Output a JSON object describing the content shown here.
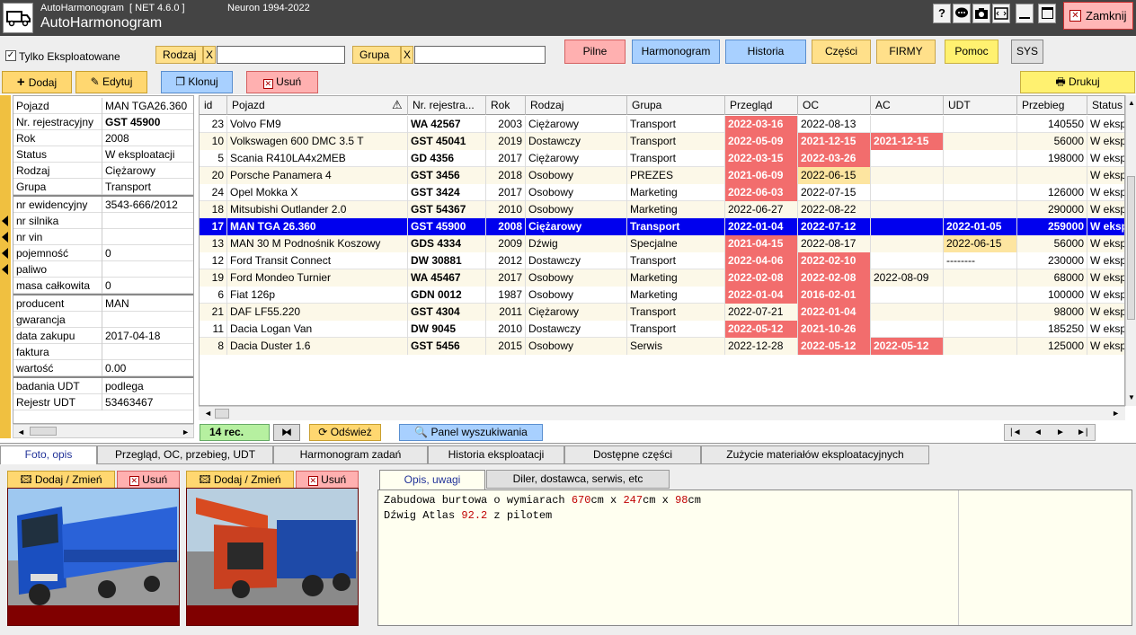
{
  "titlebar": {
    "app_small": "AutoHarmonogram  [ NET 4.6.0 ]",
    "app_title": "AutoHarmonogram",
    "version": "Neuron 1994-2022",
    "close_label": "Zamknij",
    "icons": [
      "help-icon",
      "chat-icon",
      "camera-icon",
      "screen-icon",
      "minimize-icon",
      "maximize-icon"
    ]
  },
  "filters": {
    "exploit_label": "Tylko Eksploatowane",
    "rodzaj_label": "Rodzaj",
    "grupa_label": "Grupa",
    "clear": "X",
    "rodzaj_value": "",
    "grupa_value": ""
  },
  "top_buttons": [
    "Pilne",
    "Harmonogram",
    "Historia",
    "Części",
    "FIRMY",
    "Pomoc",
    "SYS"
  ],
  "actions": {
    "add": "Dodaj",
    "edit": "Edytuj",
    "clone": "Klonuj",
    "delete": "Usuń",
    "print": "Drukuj"
  },
  "details": [
    {
      "k": "Pojazd",
      "v": "MAN TGA26.360"
    },
    {
      "k": "Nr. rejestracyjny",
      "v": "GST 45900",
      "bold": true
    },
    {
      "k": "Rok",
      "v": "2008"
    },
    {
      "k": "Status",
      "v": "W eksploatacji"
    },
    {
      "k": "Rodzaj",
      "v": "Ciężarowy"
    },
    {
      "k": "Grupa",
      "v": "Transport"
    },
    {
      "k": "nr ewidencyjny",
      "v": "3543-666/2012"
    },
    {
      "k": "nr silnika",
      "v": ""
    },
    {
      "k": "nr vin",
      "v": ""
    },
    {
      "k": "pojemność",
      "v": "0"
    },
    {
      "k": "paliwo",
      "v": ""
    },
    {
      "k": "masa całkowita",
      "v": "0"
    },
    {
      "k": "producent",
      "v": "MAN"
    },
    {
      "k": "gwarancja",
      "v": ""
    },
    {
      "k": "data zakupu",
      "v": "2017-04-18"
    },
    {
      "k": "faktura",
      "v": ""
    },
    {
      "k": "wartość",
      "v": "0.00"
    },
    {
      "k": "badania UDT",
      "v": "podlega"
    },
    {
      "k": "Rejestr UDT",
      "v": "53463467"
    }
  ],
  "grid": {
    "headers": [
      "id",
      "Pojazd",
      "Nr. rejestra...",
      "Rok",
      "Rodzaj",
      "Grupa",
      "Przegląd",
      "OC",
      "AC",
      "UDT",
      "Przebieg",
      "Status"
    ],
    "rows": [
      {
        "id": "23",
        "pojazd": "Volvo FM9",
        "nr": "WA 42567",
        "rok": "2003",
        "rodzaj": "Ciężarowy",
        "grupa": "Transport",
        "przeglad": "2022-03-16",
        "oc": "2022-08-13",
        "ac": "",
        "udt": "",
        "przebieg": "140550",
        "status": "W eksploatacji",
        "cls": [
          "red",
          "",
          "",
          ""
        ]
      },
      {
        "id": "10",
        "pojazd": "Volkswagen 600 DMC 3.5 T",
        "nr": "GST 45041",
        "rok": "2019",
        "rodzaj": "Dostawczy",
        "grupa": "Transport",
        "przeglad": "2022-05-09",
        "oc": "2021-12-15",
        "ac": "2021-12-15",
        "udt": "",
        "przebieg": "56000",
        "status": "W eksploatacji",
        "cls": [
          "red",
          "red",
          "red",
          ""
        ]
      },
      {
        "id": "5",
        "pojazd": "Scania R410LA4x2MEB",
        "nr": "GD 4356",
        "rok": "2017",
        "rodzaj": "Ciężarowy",
        "grupa": "Transport",
        "przeglad": "2022-03-15",
        "oc": "2022-03-26",
        "ac": "",
        "udt": "",
        "przebieg": "198000",
        "status": "W eksploatacji",
        "cls": [
          "red",
          "red",
          "",
          ""
        ]
      },
      {
        "id": "20",
        "pojazd": "Porsche Panamera 4",
        "nr": "GST 3456",
        "rok": "2018",
        "rodzaj": "Osobowy",
        "grupa": "PREZES",
        "przeglad": "2021-06-09",
        "oc": "2022-06-15",
        "ac": "",
        "udt": "",
        "przebieg": "",
        "status": "W eksploatacji",
        "cls": [
          "red",
          "yel",
          "",
          ""
        ]
      },
      {
        "id": "24",
        "pojazd": "Opel Mokka X",
        "nr": "GST 3424",
        "rok": "2017",
        "rodzaj": "Osobowy",
        "grupa": "Marketing",
        "przeglad": "2022-06-03",
        "oc": "2022-07-15",
        "ac": "",
        "udt": "",
        "przebieg": "126000",
        "status": "W eksploatacji",
        "cls": [
          "red",
          "",
          "",
          ""
        ]
      },
      {
        "id": "18",
        "pojazd": "Mitsubishi Outlander 2.0",
        "nr": "GST 54367",
        "rok": "2010",
        "rodzaj": "Osobowy",
        "grupa": "Marketing",
        "przeglad": "2022-06-27",
        "oc": "2022-08-22",
        "ac": "",
        "udt": "",
        "przebieg": "290000",
        "status": "W eksploatacji",
        "cls": [
          "",
          "",
          "",
          ""
        ]
      },
      {
        "id": "17",
        "pojazd": "MAN TGA 26.360",
        "nr": "GST 45900",
        "rok": "2008",
        "rodzaj": "Ciężarowy",
        "grupa": "Transport",
        "przeglad": "2022-01-04",
        "oc": "2022-07-12",
        "ac": "",
        "udt": "2022-01-05",
        "przebieg": "259000",
        "status": "W eksploatacji",
        "cls": [
          "",
          "",
          "",
          ""
        ],
        "selected": true
      },
      {
        "id": "13",
        "pojazd": "MAN 30 M Podnośnik Koszowy",
        "nr": "GDS 4334",
        "rok": "2009",
        "rodzaj": "Dźwig",
        "grupa": "Specjalne",
        "przeglad": "2021-04-15",
        "oc": "2022-08-17",
        "ac": "",
        "udt": "2022-06-15",
        "przebieg": "56000",
        "status": "W eksploatacji",
        "cls": [
          "red",
          "",
          "",
          "yel"
        ]
      },
      {
        "id": "12",
        "pojazd": "Ford Transit Connect",
        "nr": "DW 30881",
        "rok": "2012",
        "rodzaj": "Dostawczy",
        "grupa": "Transport",
        "przeglad": "2022-04-06",
        "oc": "2022-02-10",
        "ac": "",
        "udt": "--------",
        "przebieg": "230000",
        "status": "W eksploatacji",
        "cls": [
          "red",
          "red",
          "",
          ""
        ]
      },
      {
        "id": "19",
        "pojazd": "Ford Mondeo Turnier",
        "nr": "WA 45467",
        "rok": "2017",
        "rodzaj": "Osobowy",
        "grupa": "Marketing",
        "przeglad": "2022-02-08",
        "oc": "2022-02-08",
        "ac": "2022-08-09",
        "udt": "",
        "przebieg": "68000",
        "status": "W eksploatacji",
        "cls": [
          "red",
          "red",
          "",
          ""
        ]
      },
      {
        "id": "6",
        "pojazd": "Fiat 126p",
        "nr": "GDN 0012",
        "rok": "1987",
        "rodzaj": "Osobowy",
        "grupa": "Marketing",
        "przeglad": "2022-01-04",
        "oc": "2016-02-01",
        "ac": "",
        "udt": "",
        "przebieg": "100000",
        "status": "W eksploatacji",
        "cls": [
          "red",
          "red",
          "",
          ""
        ]
      },
      {
        "id": "21",
        "pojazd": "DAF LF55.220",
        "nr": "GST 4304",
        "rok": "2011",
        "rodzaj": "Ciężarowy",
        "grupa": "Transport",
        "przeglad": "2022-07-21",
        "oc": "2022-01-04",
        "ac": "",
        "udt": "",
        "przebieg": "98000",
        "status": "W eksploatacji",
        "cls": [
          "",
          "red",
          "",
          ""
        ]
      },
      {
        "id": "11",
        "pojazd": "Dacia Logan Van",
        "nr": "DW 9045",
        "rok": "2010",
        "rodzaj": "Dostawczy",
        "grupa": "Transport",
        "przeglad": "2022-05-12",
        "oc": "2021-10-26",
        "ac": "",
        "udt": "",
        "przebieg": "185250",
        "status": "W eksploatacji",
        "cls": [
          "red",
          "red",
          "",
          ""
        ]
      },
      {
        "id": "8",
        "pojazd": "Dacia Duster 1.6",
        "nr": "GST 5456",
        "rok": "2015",
        "rodzaj": "Osobowy",
        "grupa": "Serwis",
        "przeglad": "2022-12-28",
        "oc": "2022-05-12",
        "ac": "2022-05-12",
        "udt": "",
        "przebieg": "125000",
        "status": "W eksploatacji",
        "cls": [
          "",
          "red",
          "red",
          ""
        ]
      }
    ]
  },
  "status": {
    "records": "14 rec.",
    "refresh": "Odśwież",
    "search_panel": "Panel wyszukiwania"
  },
  "bottom_tabs": [
    "Foto, opis",
    "Przegląd, OC, przebieg, UDT",
    "Harmonogram zadań",
    "Historia eksploatacji",
    "Dostępne części",
    "Zużycie materiałów eksploatacyjnych"
  ],
  "photos": {
    "add_change": "Dodaj / Zmień",
    "delete": "Usuń"
  },
  "notes": {
    "tabs": [
      "Opis, uwagi",
      "Diler, dostawca, serwis, etc"
    ],
    "line1_a": "Zabudowa burtowa o wymiarach ",
    "line1_n1": "670",
    "line1_b": "cm x ",
    "line1_n2": "247",
    "line1_c": "cm x ",
    "line1_n3": "98",
    "line1_d": "cm",
    "line2_a": "Dźwig Atlas ",
    "line2_n": "92.2",
    "line2_b": " z pilotem"
  },
  "colors": {
    "red_cell": "#f26d6d",
    "yellow_cell": "#fde5a0",
    "selected_row": "#0000ee",
    "titlebar": "#444444"
  }
}
